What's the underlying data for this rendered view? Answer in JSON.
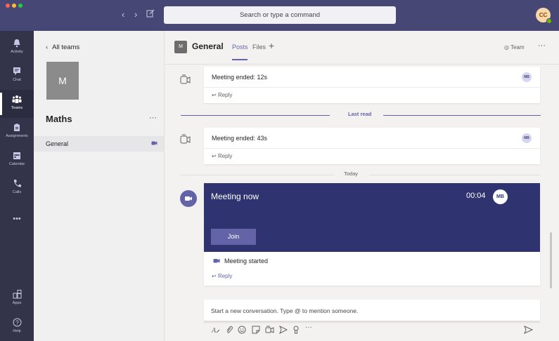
{
  "titlebar": {
    "search_placeholder": "Search or type a command",
    "user_initials": "CC"
  },
  "rail": {
    "items": [
      {
        "label": "Activity"
      },
      {
        "label": "Chat"
      },
      {
        "label": "Teams"
      },
      {
        "label": "Assignments"
      },
      {
        "label": "Calendar"
      },
      {
        "label": "Calls"
      },
      {
        "label": "Apps"
      },
      {
        "label": "Help"
      }
    ],
    "more": "•••"
  },
  "teams_panel": {
    "back_label": "All teams",
    "team_initial": "M",
    "team_name": "Maths",
    "more": "···",
    "channels": [
      {
        "name": "General"
      }
    ]
  },
  "header": {
    "tile": "M",
    "channel": "General",
    "tabs": [
      "Posts",
      "Files"
    ],
    "add": "+",
    "team_btn": "◎ Team",
    "more": "···"
  },
  "feed": {
    "messages": [
      {
        "title": "Meeting ended: 12s",
        "badge": "MB",
        "reply": "Reply"
      },
      {
        "title": "Meeting ended: 43s",
        "badge": "MB",
        "reply": "Reply"
      }
    ],
    "last_read": "Last read",
    "today": "Today",
    "meeting": {
      "title": "Meeting now",
      "timer": "00:04",
      "badge": "MB",
      "join": "Join",
      "started": "Meeting started",
      "reply": "Reply"
    },
    "compose_placeholder": "Start a new conversation. Type @ to mention someone.",
    "toolbar_more": "···"
  },
  "colors": {
    "accent": "#6264a7",
    "titlebar": "#464775",
    "rail": "#33344a",
    "meeting_banner": "#2f3470"
  }
}
